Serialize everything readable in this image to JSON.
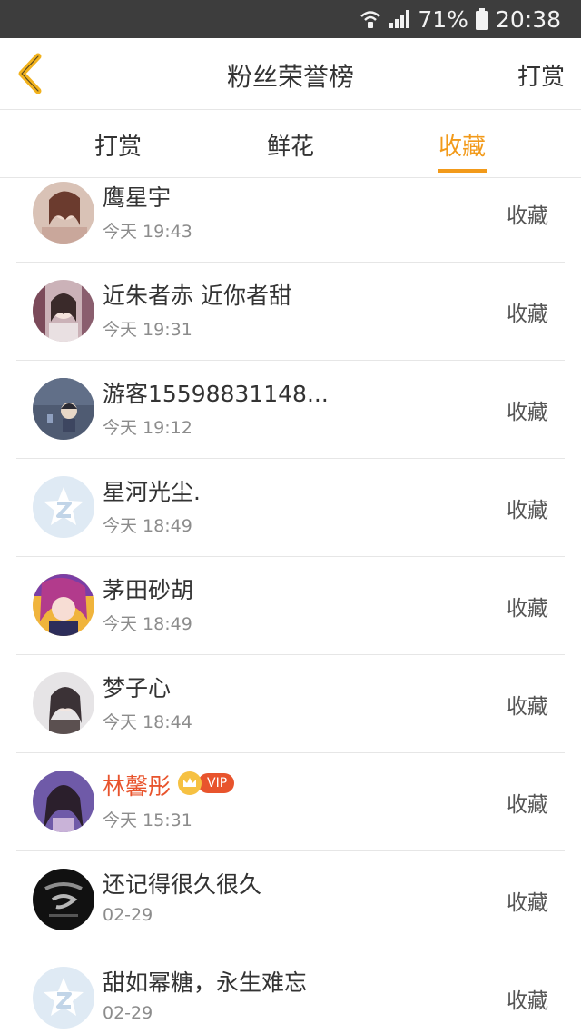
{
  "status_bar": {
    "battery": "71%",
    "time": "20:38"
  },
  "header": {
    "title": "粉丝荣誉榜",
    "action_label": "打赏"
  },
  "tabs": [
    {
      "label": "打赏",
      "active": false
    },
    {
      "label": "鲜花",
      "active": false
    },
    {
      "label": "收藏",
      "active": true
    }
  ],
  "fans": [
    {
      "name": "鹰星宇",
      "time": "今天 19:43",
      "action": "收藏",
      "avatar": "photo-portrait-avatar"
    },
    {
      "name": "近朱者赤 近你者甜",
      "time": "今天 19:31",
      "action": "收藏",
      "avatar": "photo-portrait-avatar"
    },
    {
      "name": "游客15598831148...",
      "time": "今天 19:12",
      "action": "收藏",
      "avatar": "cartoon-avatar"
    },
    {
      "name": "星河光尘.",
      "time": "今天 18:49",
      "action": "收藏",
      "avatar": "default-star-avatar"
    },
    {
      "name": "茅田砂胡",
      "time": "今天 18:49",
      "action": "收藏",
      "avatar": "anime-avatar"
    },
    {
      "name": "梦子心",
      "time": "今天 18:44",
      "action": "收藏",
      "avatar": "photo-portrait-avatar"
    },
    {
      "name": "林馨彤",
      "time": "今天 15:31",
      "action": "收藏",
      "avatar": "photo-portrait-avatar",
      "vip": "VIP"
    },
    {
      "name": "还记得很久很久",
      "time": "02-29",
      "action": "收藏",
      "avatar": "dark-logo-avatar"
    },
    {
      "name": "甜如幂糖，永生难忘",
      "time": "02-29",
      "action": "收藏",
      "avatar": "default-star-avatar"
    }
  ],
  "colors": {
    "accent": "#f29a1a",
    "vip_name": "#e8542d",
    "status_bar_bg": "#3d3d3d"
  }
}
